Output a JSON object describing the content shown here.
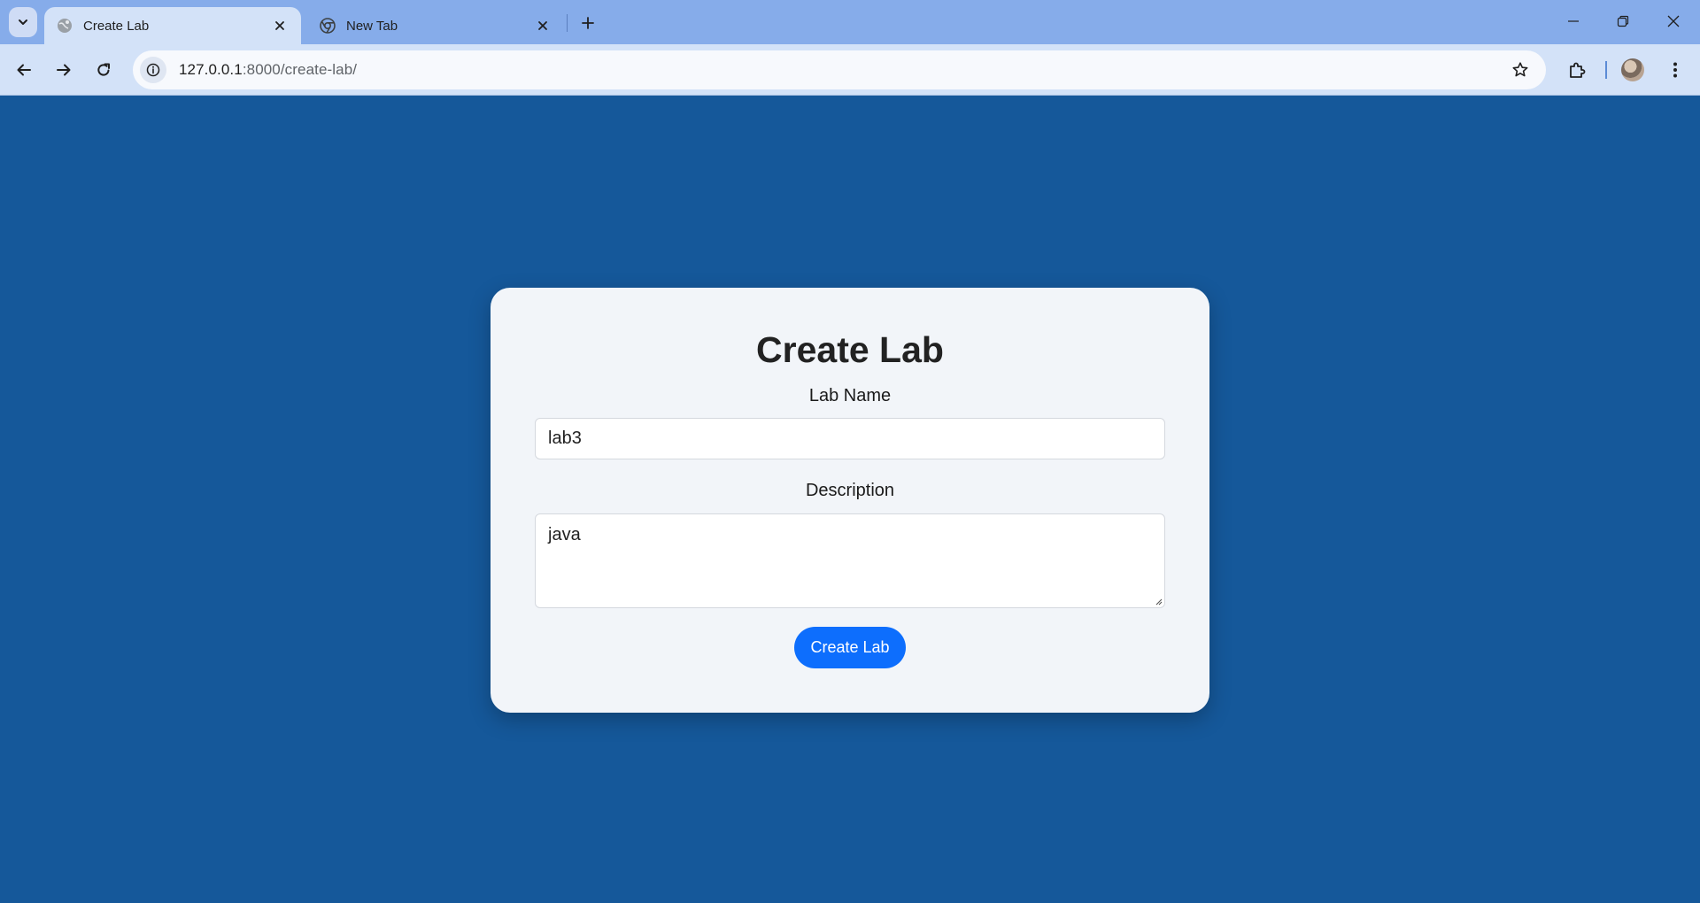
{
  "browser": {
    "tabs": [
      {
        "title": "Create Lab",
        "active": true,
        "favicon": "globe-icon"
      },
      {
        "title": "New Tab",
        "active": false,
        "favicon": "chrome-icon"
      }
    ],
    "address": {
      "host": "127.0.0.1",
      "path": ":8000/create-lab/"
    }
  },
  "page": {
    "background_color": "#15589a",
    "title": "Create Lab",
    "form": {
      "lab_name_label": "Lab Name",
      "lab_name_value": "lab3",
      "description_label": "Description",
      "description_value": "java",
      "submit_label": "Create Lab"
    },
    "button_color": "#0d6efd"
  }
}
